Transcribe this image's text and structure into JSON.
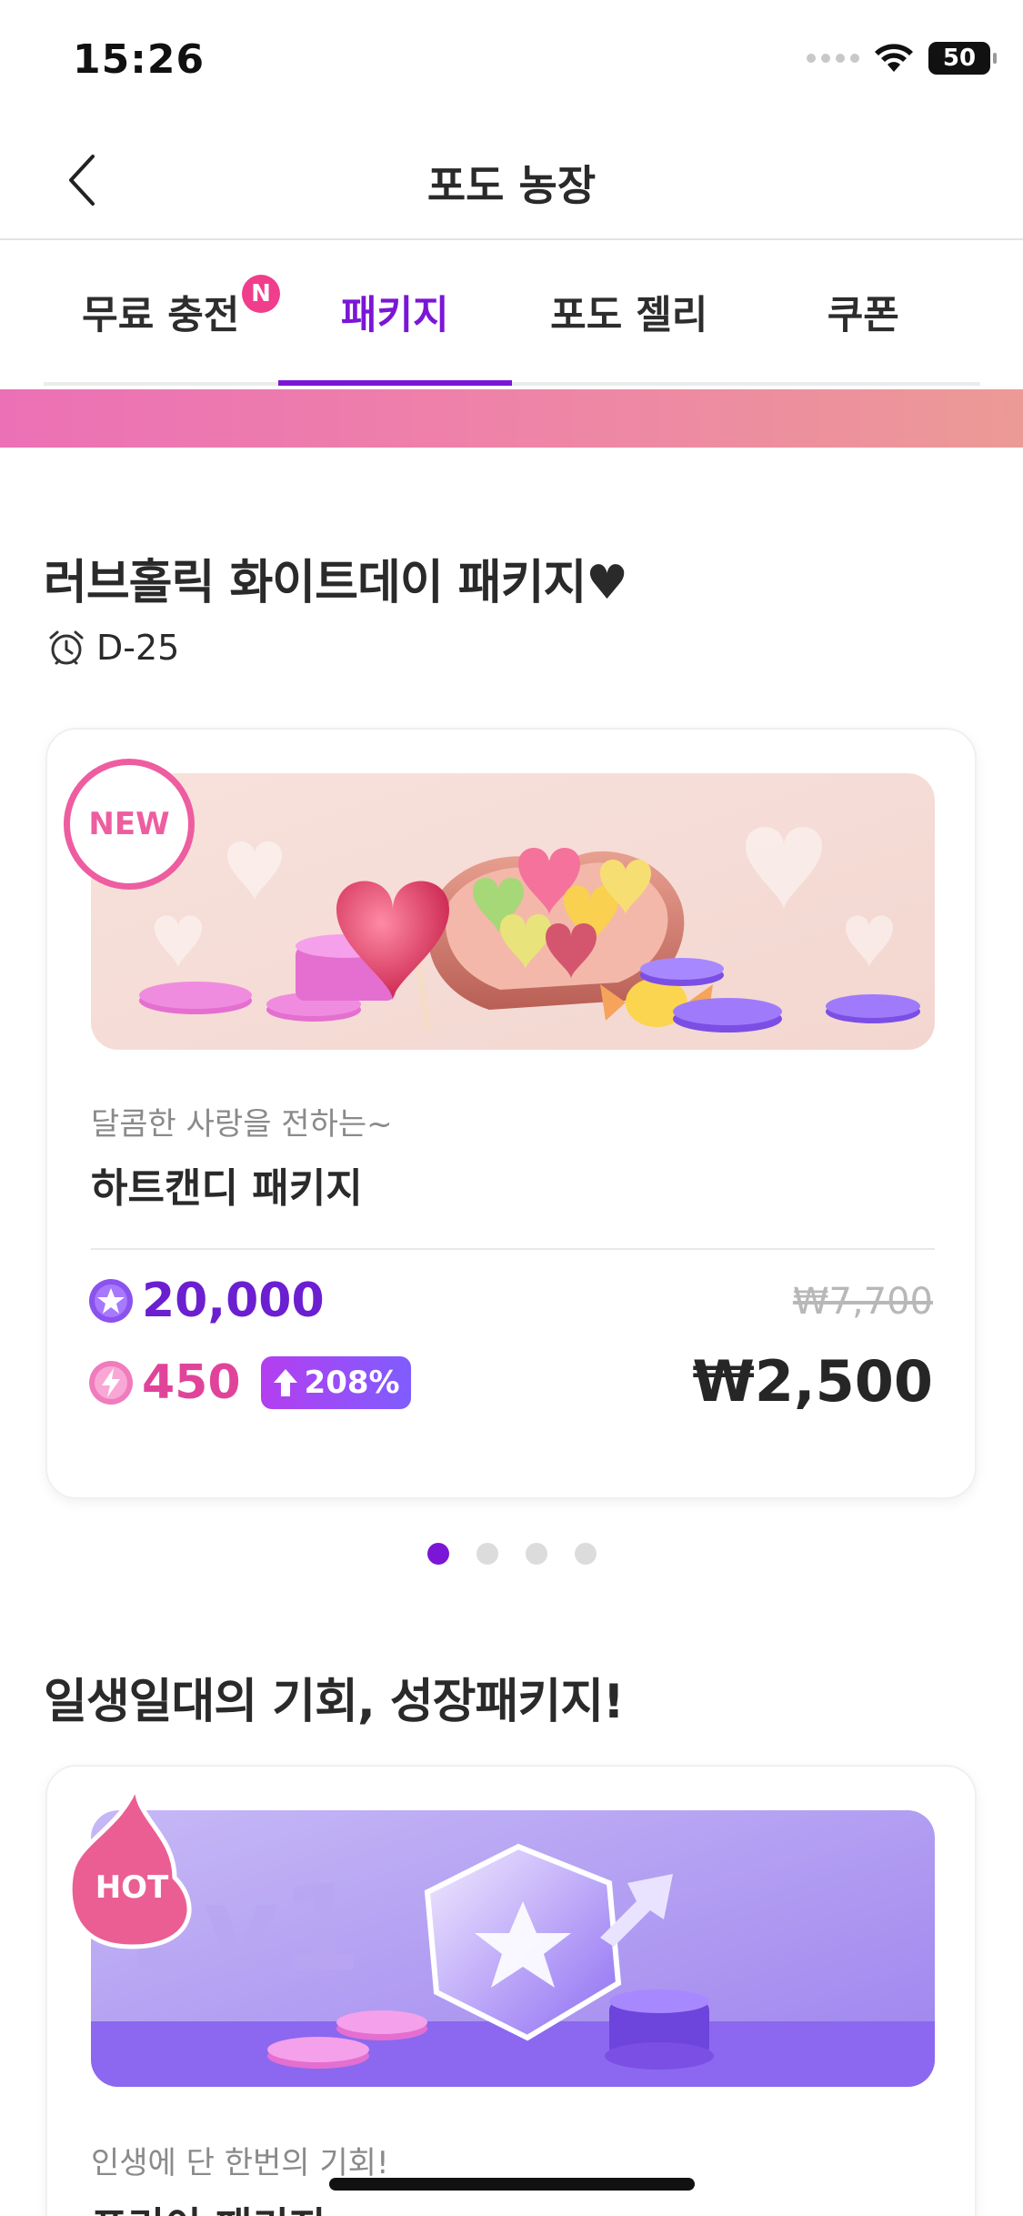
{
  "status": {
    "time": "15:26",
    "battery": "50"
  },
  "nav": {
    "title": "포도 농장"
  },
  "tabs": [
    {
      "label": "무료 충전",
      "badge": "N"
    },
    {
      "label": "패키지"
    },
    {
      "label": "포도 젤리"
    },
    {
      "label": "쿠폰"
    }
  ],
  "section1": {
    "title": "러브홀릭 화이트데이 패키지♥",
    "timer": "D-25",
    "card": {
      "badge": "NEW",
      "subtitle": "달콤한 사랑을 전하는~",
      "name": "하트캔디 패키지",
      "amount": "20,000",
      "bonus": "450",
      "bonus_pct": "208%",
      "old_price": "₩7,700",
      "price": "₩2,500"
    },
    "carousel": {
      "total": 4,
      "active": 0
    }
  },
  "section2": {
    "title": "일생일대의 기회, 성장패키지!",
    "card": {
      "badge": "HOT",
      "banner_text": "Lv1",
      "subtitle": "인생에 단 한번의 기회!",
      "name": "프리이 패키지"
    }
  },
  "colors": {
    "accent": "#7b16d6",
    "pink": "#e0449a"
  }
}
